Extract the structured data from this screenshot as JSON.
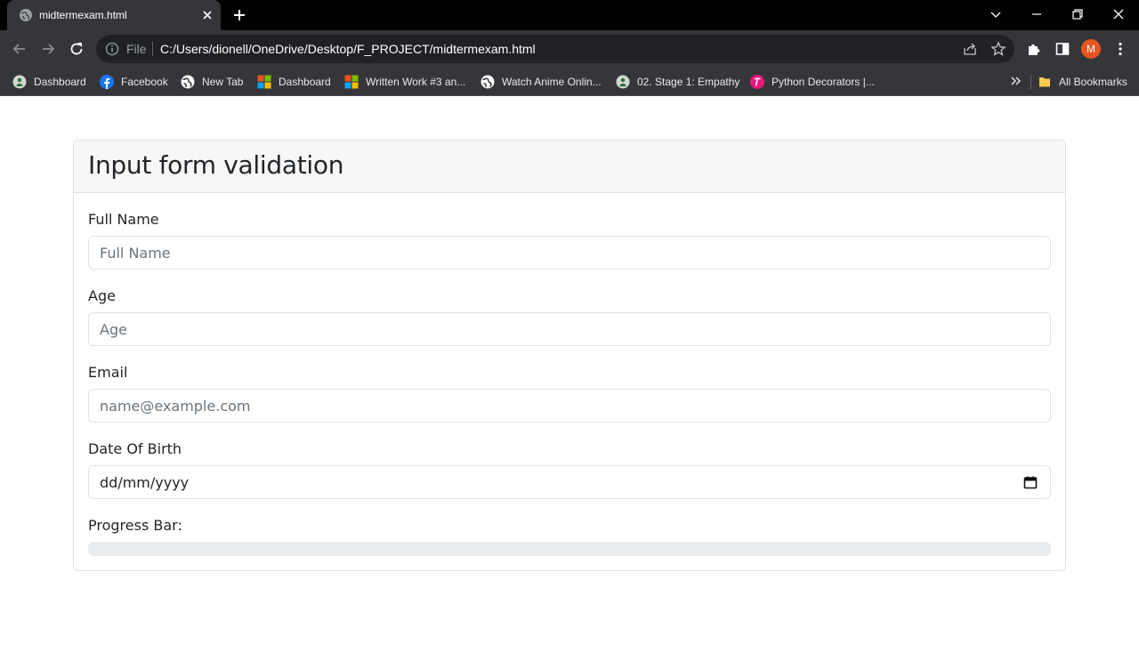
{
  "tab": {
    "title": "midtermexam.html"
  },
  "omnibox": {
    "scheme": "File",
    "url": "C:/Users/dionell/OneDrive/Desktop/F_PROJECT/midtermexam.html"
  },
  "profile": {
    "initial": "M"
  },
  "bookmarks": [
    {
      "label": "Dashboard",
      "icon": "moodle-icon"
    },
    {
      "label": "Facebook",
      "icon": "facebook-icon"
    },
    {
      "label": "New Tab",
      "icon": "globe-icon"
    },
    {
      "label": "Dashboard",
      "icon": "microsoft-icon"
    },
    {
      "label": "Written Work #3 an...",
      "icon": "microsoft-icon"
    },
    {
      "label": "Watch Anime Onlin...",
      "icon": "globe-icon"
    },
    {
      "label": "02. Stage 1: Empathy",
      "icon": "moodle-icon"
    },
    {
      "label": "Python Decorators |...",
      "icon": "tumblr-icon"
    }
  ],
  "all_bookmarks": "All Bookmarks",
  "form": {
    "title": "Input form validation",
    "full_name": {
      "label": "Full Name",
      "placeholder": "Full Name",
      "value": ""
    },
    "age": {
      "label": "Age",
      "placeholder": "Age",
      "value": ""
    },
    "email": {
      "label": "Email",
      "placeholder": "name@example.com",
      "value": ""
    },
    "dob": {
      "label": "Date Of Birth",
      "value": "dd/mm/yyyy"
    },
    "progress": {
      "label": "Progress Bar:",
      "value": 0
    }
  },
  "colors": {
    "chrome_bg": "#35363a",
    "tabstrip_bg": "#000000",
    "accent": "#0d6efd",
    "avatar": "#e8541f"
  }
}
